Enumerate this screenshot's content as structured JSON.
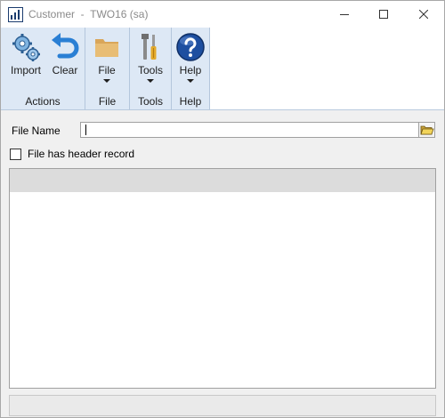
{
  "window": {
    "title": "Customer  -  TWO16 (sa)",
    "controls": {
      "minimize": "minimize-icon",
      "maximize": "maximize-icon",
      "close": "close-icon"
    }
  },
  "ribbon": {
    "groups": [
      {
        "label": "Actions",
        "buttons": [
          {
            "label": "Import",
            "icon": "import-gears-icon"
          },
          {
            "label": "Clear",
            "icon": "clear-undo-arrow-icon"
          }
        ]
      },
      {
        "label": "File",
        "buttons": [
          {
            "label": "File",
            "icon": "folder-icon"
          }
        ]
      },
      {
        "label": "Tools",
        "buttons": [
          {
            "label": "Tools",
            "icon": "tools-icon"
          }
        ]
      },
      {
        "label": "Help",
        "buttons": [
          {
            "label": "Help",
            "icon": "help-icon"
          }
        ]
      }
    ]
  },
  "form": {
    "file_name_label": "File Name",
    "file_name_value": "",
    "browse_icon": "folder-browse-icon",
    "header_checkbox_label": "File has header record",
    "header_checkbox_checked": false
  },
  "colors": {
    "ribbon_group_bg": "#dde8f5",
    "help_blue": "#1e4fa0",
    "clear_blue": "#2a7fd4",
    "folder_tan": "#e0b36a"
  }
}
